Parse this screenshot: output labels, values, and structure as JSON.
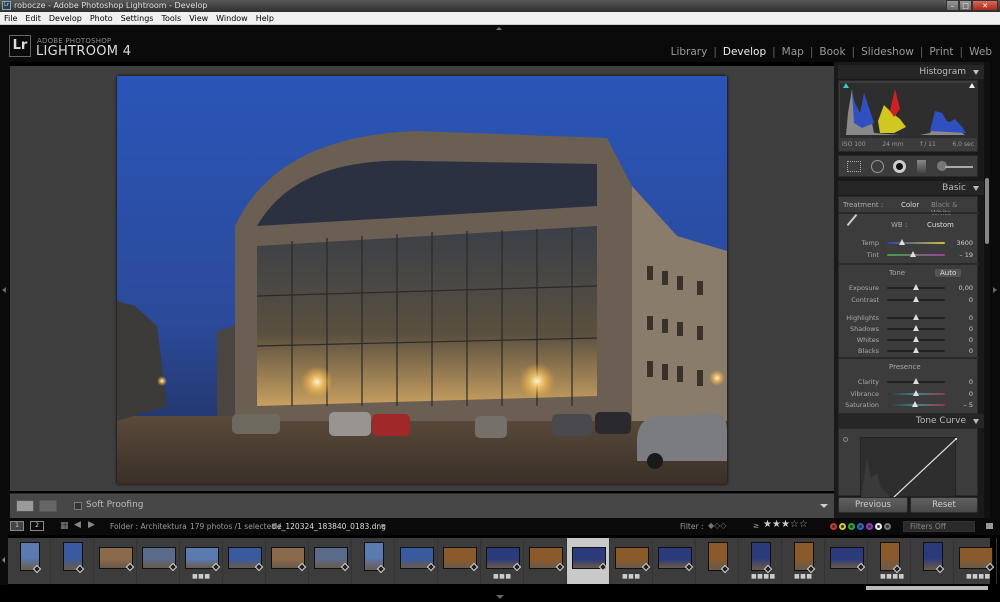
{
  "window": {
    "title": "robocze - Adobe Photoshop Lightroom - Develop",
    "controls": [
      "minimize",
      "maximize",
      "close"
    ]
  },
  "menubar": [
    "File",
    "Edit",
    "Develop",
    "Photo",
    "Settings",
    "Tools",
    "View",
    "Window",
    "Help"
  ],
  "brand": {
    "logo": "Lr",
    "small": "ADOBE PHOTOSHOP",
    "big": "LIGHTROOM 4"
  },
  "modules": [
    {
      "label": "Library",
      "active": false
    },
    {
      "label": "Develop",
      "active": true
    },
    {
      "label": "Map",
      "active": false
    },
    {
      "label": "Book",
      "active": false
    },
    {
      "label": "Slideshow",
      "active": false
    },
    {
      "label": "Print",
      "active": false
    },
    {
      "label": "Web",
      "active": false
    }
  ],
  "toolbar": {
    "soft_proofing_label": "Soft Proofing",
    "soft_proofing_checked": false
  },
  "histogram": {
    "title": "Histogram",
    "iso": "ISO 100",
    "focal": "24 mm",
    "aperture": "f / 11",
    "shutter": "6,0 sec"
  },
  "basic": {
    "title": "Basic",
    "treatment_label": "Treatment :",
    "treatment_color": "Color",
    "treatment_bw": "Black & White",
    "wb_label": "WB :",
    "wb_value": "Custom",
    "temp": {
      "label": "Temp",
      "value": "3600",
      "pos": 0.25
    },
    "tint": {
      "label": "Tint",
      "value": "– 19",
      "pos": 0.45
    },
    "tone_label": "Tone",
    "auto_label": "Auto",
    "tone_sliders": [
      {
        "label": "Exposure",
        "value": "0,00",
        "pos": 0.5
      },
      {
        "label": "Contrast",
        "value": "0",
        "pos": 0.5
      },
      {
        "label": "Highlights",
        "value": "0",
        "pos": 0.5
      },
      {
        "label": "Shadows",
        "value": "0",
        "pos": 0.5
      },
      {
        "label": "Whites",
        "value": "0",
        "pos": 0.5
      },
      {
        "label": "Blacks",
        "value": "0",
        "pos": 0.5
      }
    ],
    "presence_label": "Presence",
    "presence_sliders": [
      {
        "label": "Clarity",
        "value": "0",
        "pos": 0.5
      },
      {
        "label": "Vibrance",
        "value": "0",
        "pos": 0.5
      },
      {
        "label": "Saturation",
        "value": "– 5",
        "pos": 0.48
      }
    ]
  },
  "tone_curve": {
    "title": "Tone Curve"
  },
  "buttons": {
    "previous": "Previous",
    "reset": "Reset"
  },
  "filmbar": {
    "monitor1": "1",
    "monitor2": "2",
    "folder": "Folder : Architektura",
    "count": "179 photos /1 selected /",
    "filename": "tle_120324_183840_0183.dng",
    "filter_label": "Filter :",
    "rating_op": "≥",
    "stars": 3,
    "filters_off": "Filters Off",
    "color_labels": [
      "#c33",
      "#cc3",
      "#3a3",
      "#36c",
      "#93c",
      "#eee",
      "#777"
    ]
  },
  "filmstrip": {
    "selected_index": 13,
    "thumbs": [
      {
        "orient": "p",
        "dots": 0
      },
      {
        "orient": "p",
        "dots": 0
      },
      {
        "orient": "l",
        "dots": 0
      },
      {
        "orient": "l",
        "dots": 0
      },
      {
        "orient": "l",
        "dots": 3
      },
      {
        "orient": "l",
        "dots": 0
      },
      {
        "orient": "l",
        "dots": 0
      },
      {
        "orient": "l",
        "dots": 0
      },
      {
        "orient": "p",
        "dots": 0
      },
      {
        "orient": "l",
        "dots": 0
      },
      {
        "orient": "l",
        "dots": 0
      },
      {
        "orient": "l",
        "dots": 3
      },
      {
        "orient": "l",
        "dots": 0
      },
      {
        "orient": "l",
        "dots": 0
      },
      {
        "orient": "l",
        "dots": 3
      },
      {
        "orient": "l",
        "dots": 0
      },
      {
        "orient": "p",
        "dots": 0
      },
      {
        "orient": "p",
        "dots": 4
      },
      {
        "orient": "p",
        "dots": 3
      },
      {
        "orient": "l",
        "dots": 0
      },
      {
        "orient": "p",
        "dots": 4
      },
      {
        "orient": "p",
        "dots": 0
      },
      {
        "orient": "l",
        "dots": 4
      }
    ]
  }
}
